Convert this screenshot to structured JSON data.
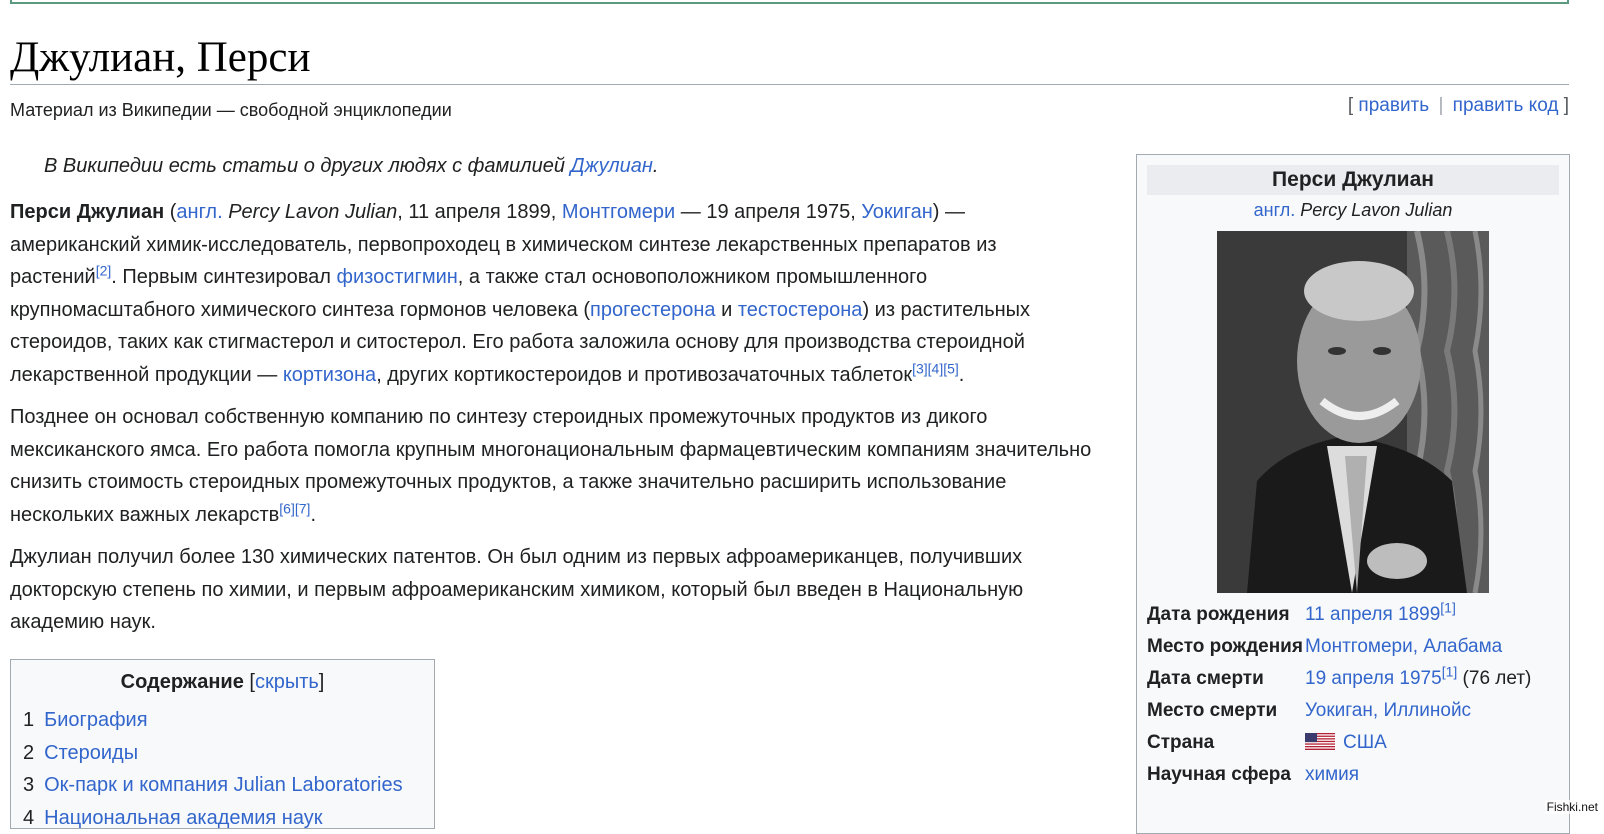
{
  "page": {
    "title": "Джулиан, Перси",
    "tagline": "Материал из Википедии — свободной энциклопедии",
    "edit_open": "[",
    "edit_label": "править",
    "edit_sep": "|",
    "edit_code_label": "править код",
    "edit_close": "]"
  },
  "hatnote": {
    "text": "В Википедии есть статьи о других людях с фамилией ",
    "link": "Джулиан",
    "end": "."
  },
  "intro": {
    "p1": {
      "name": "Перси Джулиан",
      "t1": " (",
      "lang_link": "англ.",
      "t2": " ",
      "original_name": "Percy Lavon Julian",
      "t3": ", 11 апреля 1899, ",
      "link_montgomery": "Монтгомери",
      "t4": " — 19 апреля 1975, ",
      "link_waukegan": "Уокиган",
      "t5": ") — американский химик-исследователь, первопроходец в химическом синтезе лекарственных препаратов из растений",
      "ref2": "[2]",
      "t6": ". Первым синтезировал ",
      "link_physostigmine": "физостигмин",
      "t7": ", а также стал основоположником промышленного крупномасштабного химического синтеза гормонов человека (",
      "link_progesterone": "прогестерона",
      "t8": " и ",
      "link_testosterone": "тестостерона",
      "t9": ") из растительных стероидов, таких как стигмастерол и ситостерол. Его работа заложила основу для производства стероидной лекарственной продукции — ",
      "link_cortisone": "кортизона",
      "t10": ", других кортикостероидов и противозачаточных таблеток",
      "refs": "[3][4][5]",
      "t11": "."
    },
    "p2": {
      "text": "Позднее он основал собственную компанию по синтезу стероидных промежуточных продуктов из дикого мексиканского ямса. Его работа помогла крупным многонациональным фармацевтическим компаниям значительно снизить стоимость стероидных промежуточных продуктов, а также значительно расширить использование нескольких важных лекарств",
      "refs": "[6][7]",
      "end": "."
    },
    "p3": {
      "text": "Джулиан получил более 130 химических патентов. Он был одним из первых афроамериканцев, получивших докторскую степень по химии, и первым афроамериканским химиком, который был введен в Национальную академию наук."
    }
  },
  "toc": {
    "title": "Содержание",
    "toggle_open": "[",
    "toggle_label": "скрыть",
    "toggle_close": "]",
    "items": [
      {
        "num": "1",
        "label": "Биография"
      },
      {
        "num": "2",
        "label": "Стероиды"
      },
      {
        "num": "3",
        "label": "Ок-парк и компания Julian Laboratories"
      },
      {
        "num": "4",
        "label": "Национальная академия наук"
      }
    ]
  },
  "infobox": {
    "title": "Перси Джулиан",
    "sub_lang": "англ.",
    "sub_name": "Percy Lavon Julian",
    "rows": {
      "birth_date": {
        "label": "Дата рождения",
        "value": "11 апреля 1899",
        "ref": "[1]"
      },
      "birth_place": {
        "label": "Место рождения",
        "value1": "Монтгомери",
        "sep": ", ",
        "value2": "Алабама"
      },
      "death_date": {
        "label": "Дата смерти",
        "value": "19 апреля 1975",
        "ref": "[1]",
        "extra": " (76 лет)"
      },
      "death_place": {
        "label": "Место смерти",
        "value1": "Уокиган",
        "sep": ", ",
        "value2": "Иллинойс"
      },
      "country": {
        "label": "Страна",
        "value": "США",
        "flag_icon": "us-flag-icon"
      },
      "field": {
        "label": "Научная сфера",
        "value": "химия"
      }
    }
  },
  "watermark": "Fishki.net",
  "colors": {
    "link": "#3366cc",
    "text": "#202122",
    "border": "#a2a9b1",
    "infobox_bg": "#f8f9fa"
  }
}
